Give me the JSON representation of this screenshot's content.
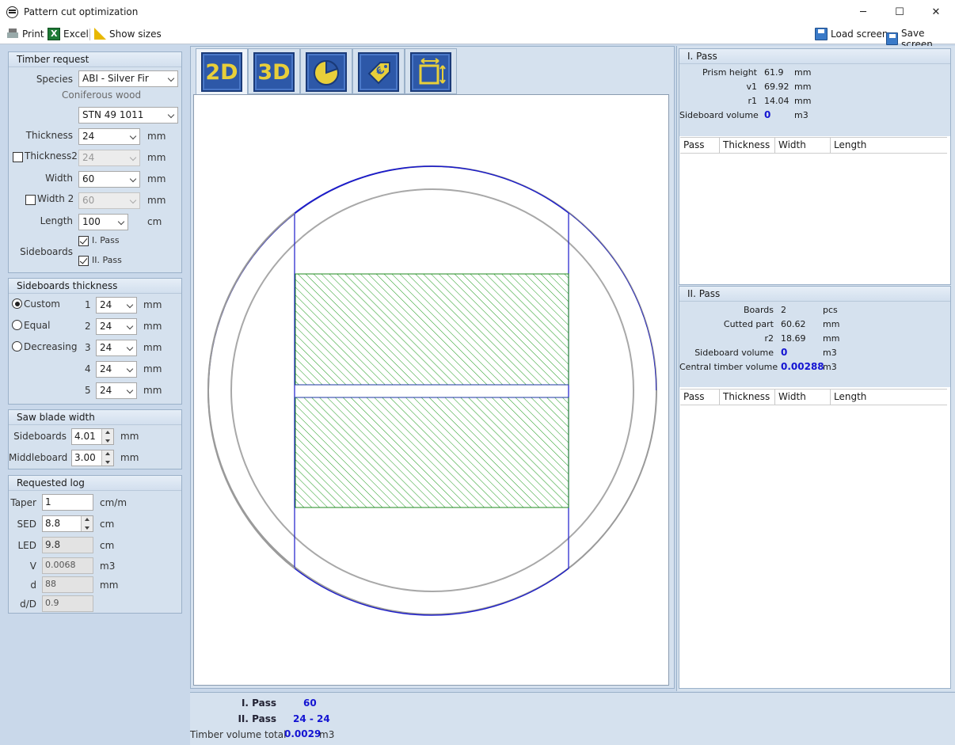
{
  "window": {
    "title": "Pattern cut optimization",
    "minimize": "─",
    "maximize": "☐",
    "close": "✕"
  },
  "toolbar": {
    "print": "Print",
    "excel": "Excel",
    "show_sizes": "Show sizes",
    "load_screen": "Load screen",
    "save_screen": "Save screen"
  },
  "timber_request": {
    "title": "Timber request",
    "species_label": "Species",
    "species_value": "ABI - Silver Fir",
    "species_subtitle": "Coniferous wood",
    "standard_value": "STN 49 1011",
    "thickness_label": "Thickness",
    "thickness_value": "24",
    "thickness_unit": "mm",
    "thickness2_label": "Thickness2",
    "thickness2_value": "24",
    "thickness2_unit": "mm",
    "width_label": "Width",
    "width_value": "60",
    "width_unit": "mm",
    "width2_label": "Width 2",
    "width2_value": "60",
    "width2_unit": "mm",
    "length_label": "Length",
    "length_value": "100",
    "length_unit": "cm",
    "sideboards_label": "Sideboards",
    "pass1_label": "I. Pass",
    "pass2_label": "II. Pass"
  },
  "sideboards_thickness": {
    "title": "Sideboards thickness",
    "modes": [
      "Custom",
      "Equal",
      "Decreasing"
    ],
    "rows": [
      {
        "n": "1",
        "value": "24"
      },
      {
        "n": "2",
        "value": "24"
      },
      {
        "n": "3",
        "value": "24"
      },
      {
        "n": "4",
        "value": "24"
      },
      {
        "n": "5",
        "value": "24"
      }
    ],
    "unit": "mm"
  },
  "saw_blade": {
    "title": "Saw blade width",
    "sideboards_label": "Sideboards",
    "sideboards_value": "4.01",
    "middleboard_label": "Middleboard",
    "middleboard_value": "3.00",
    "unit": "mm"
  },
  "requested_log": {
    "title": "Requested log",
    "taper_label": "Taper",
    "taper_value": "1",
    "taper_unit": "cm/m",
    "sed_label": "SED",
    "sed_value": "8.8",
    "sed_unit": "cm",
    "led_label": "LED",
    "led_value": "9.8",
    "led_unit": "cm",
    "v_label": "V",
    "v_value": "0.0068",
    "v_unit": "m3",
    "d_label": "d",
    "d_value": "88",
    "d_unit": "mm",
    "dd_label": "d/D",
    "dd_value": "0.9"
  },
  "view_tabs": [
    "2D",
    "3D"
  ],
  "pass1": {
    "title": "I. Pass",
    "prism_height_label": "Prism height",
    "prism_height_value": "61.9",
    "prism_height_unit": "mm",
    "v1_label": "v1",
    "v1_value": "69.92",
    "v1_unit": "mm",
    "r1_label": "r1",
    "r1_value": "14.04",
    "r1_unit": "mm",
    "sideboard_volume_label": "Sideboard volume",
    "sideboard_volume_value": "0",
    "sideboard_volume_unit": "m3",
    "columns": [
      "Pass",
      "Thickness",
      "Width",
      "Length"
    ]
  },
  "pass2": {
    "title": "II. Pass",
    "boards_label": "Boards",
    "boards_value": "2",
    "boards_unit": "pcs",
    "cutted_label": "Cutted part",
    "cutted_value": "60.62",
    "cutted_unit": "mm",
    "r2_label": "r2",
    "r2_value": "18.69",
    "r2_unit": "mm",
    "sideboard_volume_label": "Sideboard volume",
    "sideboard_volume_value": "0",
    "sideboard_volume_unit": "m3",
    "central_label": "Central timber volume",
    "central_value": "0.00288",
    "central_unit": "m3",
    "columns": [
      "Pass",
      "Thickness",
      "Width",
      "Length"
    ]
  },
  "summary": {
    "pass1_label": "I. Pass",
    "pass1_value": "60",
    "pass2_label": "II. Pass",
    "pass2_value": "24 - 24",
    "total_label": "Timber volume total",
    "total_value": "0.0029",
    "total_unit": "m3"
  },
  "colors": {
    "outer_circle": "#1a1acc",
    "inner_circle": "#9a9a9a",
    "board_hatch": "#1f9a1f",
    "tab_blue": "#2d58a8",
    "tab_glyph": "#e8cf3a"
  }
}
